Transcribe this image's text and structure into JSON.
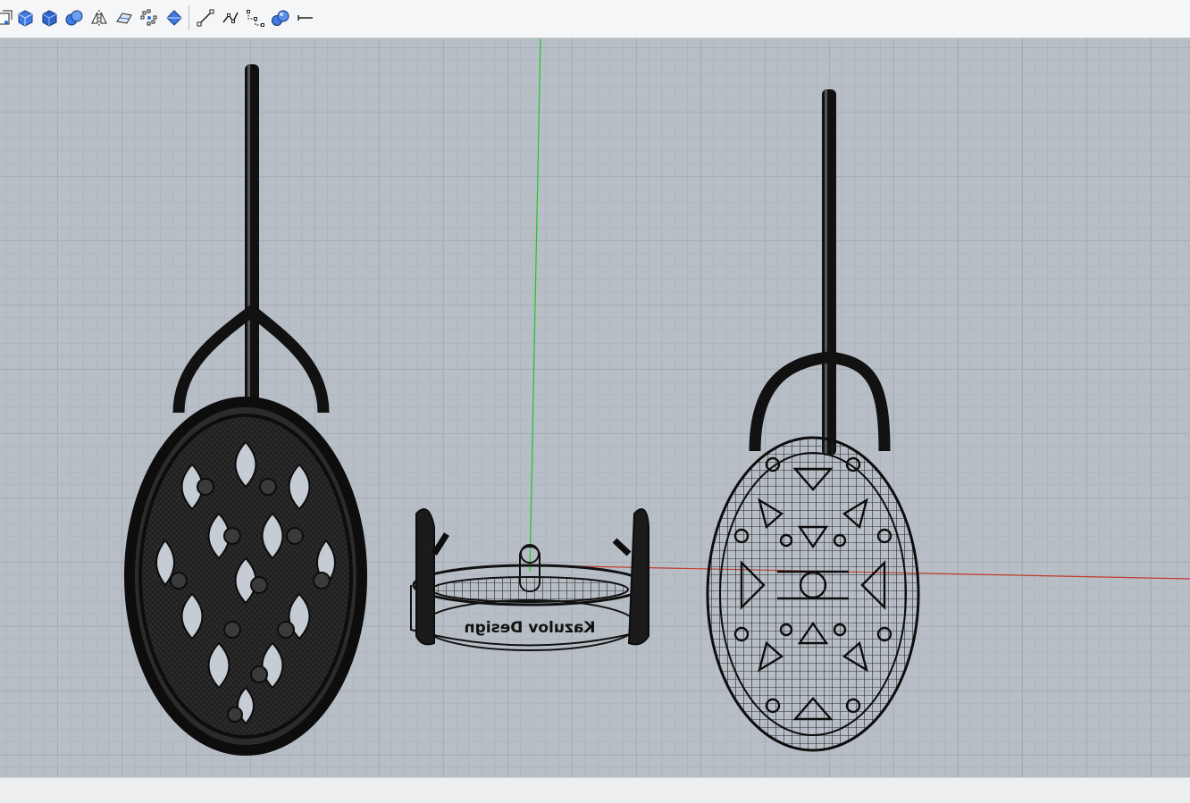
{
  "toolbar": {
    "buttons": [
      {
        "icon": "extract-surface-icon"
      },
      {
        "icon": "box-solid-icon"
      },
      {
        "icon": "box-shaded-icon"
      },
      {
        "icon": "boolean-union-icon"
      },
      {
        "icon": "mirror-icon"
      },
      {
        "icon": "surface-edit-icon"
      },
      {
        "icon": "points-on-icon"
      },
      {
        "icon": "diamond-solid-icon"
      },
      {
        "icon": "line-icon"
      },
      {
        "icon": "polyline-icon"
      },
      {
        "icon": "curve-control-points-icon"
      },
      {
        "icon": "sphere-union-icon"
      },
      {
        "icon": "dimension-icon"
      }
    ]
  },
  "viewport": {
    "background_color": "#b7bec6",
    "grid_color": "#a6adb6",
    "y_axis_color": "#22c522",
    "x_axis_color": "#c23a2c",
    "engraving_text": "Kazulov Design"
  }
}
